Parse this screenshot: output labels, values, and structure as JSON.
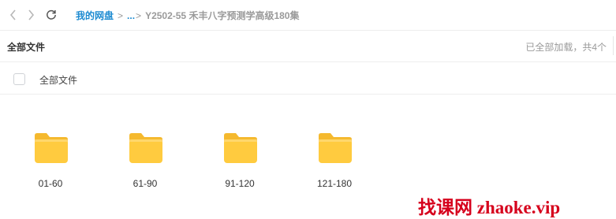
{
  "breadcrumb": {
    "root_label": "我的网盘",
    "ellipsis": "...",
    "current": "Y2502-55 禾丰八字预测学高级180集"
  },
  "header": {
    "section_title": "全部文件",
    "loaded_info": "已全部加载，共4个"
  },
  "select_all": {
    "label": "全部文件"
  },
  "folders": [
    {
      "name": "01-60"
    },
    {
      "name": "61-90"
    },
    {
      "name": "91-120"
    },
    {
      "name": "121-180"
    }
  ],
  "watermark": "找课网 zhaoke.vip",
  "colors": {
    "link": "#1d8bd1",
    "folder": "#ffc93d",
    "watermark": "#d6001c"
  },
  "icons": {
    "back": "chevron-left-icon",
    "forward": "chevron-right-icon",
    "refresh": "refresh-icon",
    "folder": "folder-icon"
  }
}
